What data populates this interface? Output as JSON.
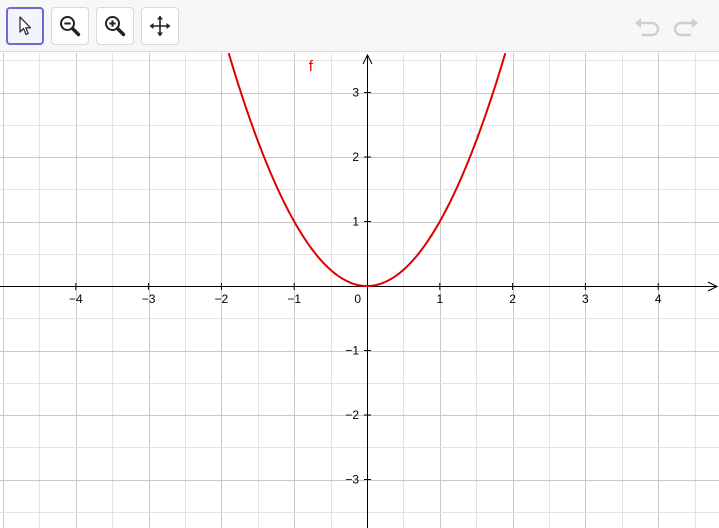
{
  "toolbar": {
    "tools": [
      {
        "name": "move-tool",
        "icon": "pointer-arrow-icon",
        "active": true
      },
      {
        "name": "zoom-out-tool",
        "icon": "zoom-out-icon",
        "active": false
      },
      {
        "name": "zoom-in-tool",
        "icon": "zoom-in-icon",
        "active": false
      },
      {
        "name": "move-graphics-view-tool",
        "icon": "four-way-arrows-icon",
        "active": false
      }
    ],
    "undo_icon": "undo-icon",
    "redo_icon": "redo-icon"
  },
  "colors": {
    "curve": "#e00000",
    "active_tool_border": "#6b6bd6",
    "grid": "#c8c8c8",
    "axes": "#000000"
  },
  "chart_data": {
    "type": "line",
    "series": [
      {
        "name": "f",
        "function": "x^2",
        "x_range": [
          -1.9,
          1.9
        ]
      }
    ],
    "xlim": [
      -5,
      4.8
    ],
    "ylim": [
      -3.6,
      3.6
    ],
    "x_ticks": [
      -4,
      -3,
      -2,
      -1,
      0,
      1,
      2,
      3,
      4
    ],
    "y_ticks": [
      -3,
      -2,
      -1,
      1,
      2,
      3
    ],
    "x_tick_labels": [
      "−4",
      "−3",
      "−2",
      "−1",
      "0",
      "1",
      "2",
      "3",
      "4"
    ],
    "y_tick_labels": [
      "−3",
      "−2",
      "−1",
      "1",
      "2",
      "3"
    ],
    "grid": true,
    "grid_step": 0.5
  }
}
